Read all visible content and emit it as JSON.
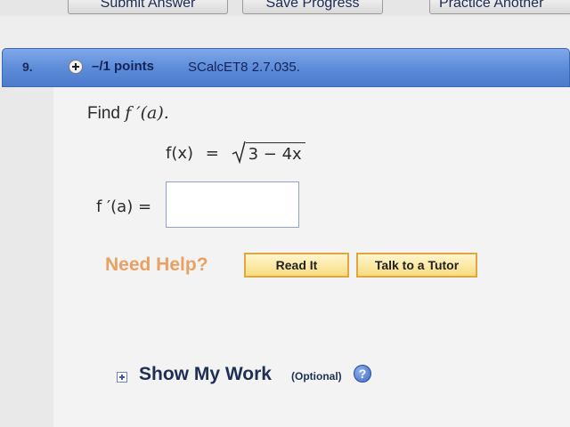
{
  "toolbar": {
    "submit_label": "Submit Answer",
    "save_label": "Save Progress",
    "practice_label": "Practice Another"
  },
  "question": {
    "number": "9.",
    "points": "–/1 points",
    "code": "SCalcET8 2.7.035.",
    "instruction_prefix": "Find ",
    "instruction_function": "f ′(a).",
    "equation_lhs": "f(x)",
    "equation_eq": "=",
    "radicand": "3 − 4x",
    "answer_label": "f ′(a) =",
    "answer_value": "",
    "answer_placeholder": ""
  },
  "help": {
    "need_help": "Need Help?",
    "read_it": "Read It",
    "talk_to_tutor": "Talk to a Tutor"
  },
  "show_my_work": {
    "title": "Show My Work",
    "optional": "(Optional)",
    "help_icon_glyph": "?"
  },
  "icons": {
    "expand_question": "plus-circle-icon",
    "expand_work": "plus-square-icon",
    "sqrt": "square-root-icon",
    "help": "question-mark-icon"
  },
  "colors": {
    "header_blue": "#5b8ad8",
    "need_help_orange": "#e8a163",
    "help_button_fill": "#f7dd80",
    "help_button_border": "#e0a640",
    "text_navy": "#1e2f55"
  }
}
